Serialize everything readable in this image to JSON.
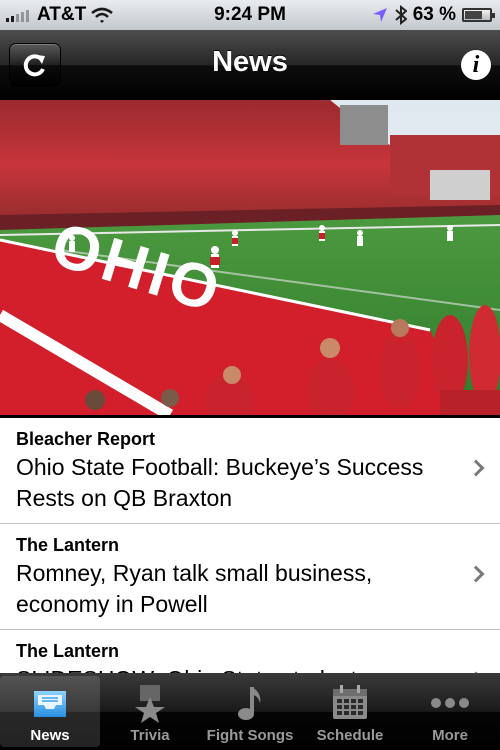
{
  "status_bar": {
    "carrier": "AT&T",
    "time": "9:24 PM",
    "battery": "63 %"
  },
  "nav": {
    "title": "News",
    "refresh_icon": "refresh-icon",
    "info_icon": "info-icon"
  },
  "hero": {
    "field_text": "OHIO"
  },
  "news": {
    "items": [
      {
        "source": "Bleacher Report",
        "headline": "Ohio State Football: Buckeye’s Success Rests on QB Braxton"
      },
      {
        "source": "The Lantern",
        "headline": "Romney, Ryan talk small business, economy in Powell"
      },
      {
        "source": "The Lantern",
        "headline": "SLIDESHOW: Ohio State students"
      }
    ]
  },
  "tabs": [
    {
      "label": "News",
      "icon": "inbox-icon",
      "active": true
    },
    {
      "label": "Trivia",
      "icon": "medal-star-icon",
      "active": false
    },
    {
      "label": "Fight Songs",
      "icon": "music-note-icon",
      "active": false
    },
    {
      "label": "Schedule",
      "icon": "calendar-icon",
      "active": false
    },
    {
      "label": "More",
      "icon": "more-dots-icon",
      "active": false
    }
  ],
  "colors": {
    "accent_blue": "#3aa3e8",
    "scarlet": "#d21f2b",
    "field_green": "#3f8f3a"
  }
}
